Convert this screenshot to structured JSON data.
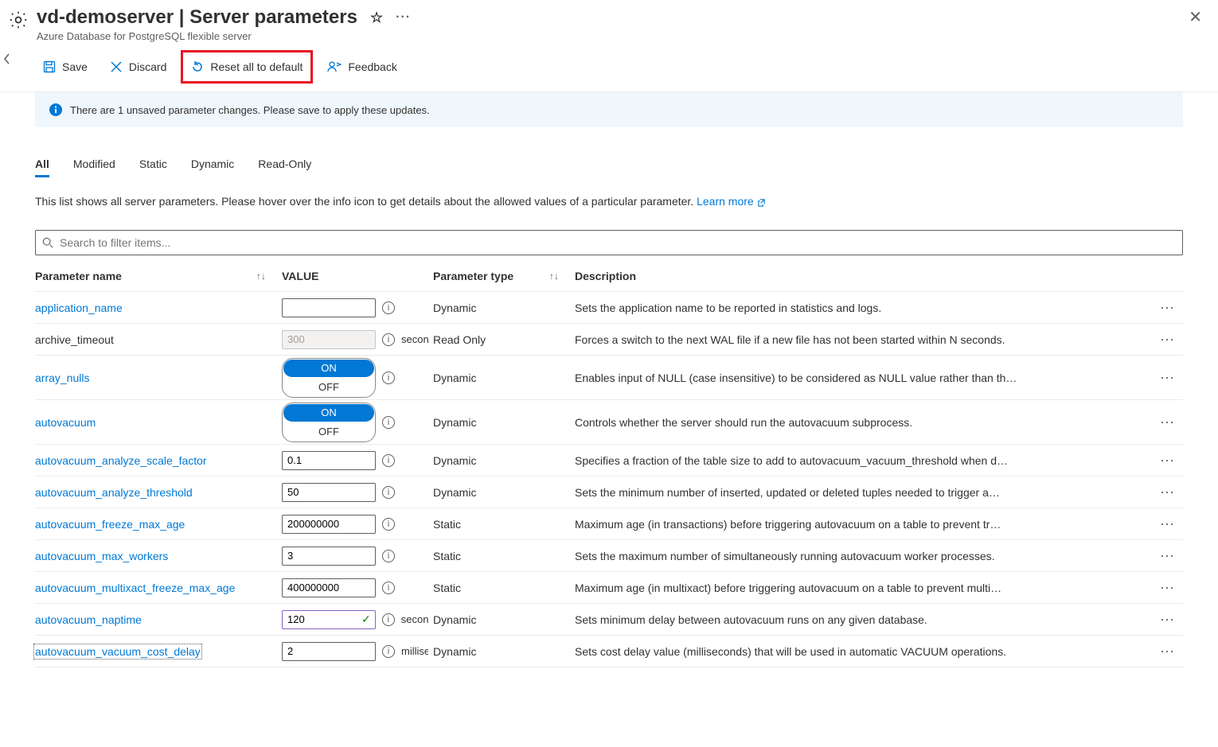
{
  "header": {
    "title": "vd-demoserver | Server parameters",
    "subtitle": "Azure Database for PostgreSQL flexible server"
  },
  "toolbar": {
    "save": "Save",
    "discard": "Discard",
    "reset": "Reset all to default",
    "feedback": "Feedback"
  },
  "info_bar": "There are 1 unsaved parameter changes.  Please save to apply these updates.",
  "tabs": [
    "All",
    "Modified",
    "Static",
    "Dynamic",
    "Read-Only"
  ],
  "desc": "This list shows all server parameters. Please hover over the info icon to get details about the allowed values of a particular parameter. ",
  "learn_more": "Learn more",
  "search_placeholder": "Search to filter items...",
  "columns": {
    "name": "Parameter name",
    "value": "VALUE",
    "type": "Parameter type",
    "desc": "Description"
  },
  "rows": [
    {
      "name": "application_name",
      "link": true,
      "value": "",
      "kind": "text",
      "type": "Dynamic",
      "desc": "Sets the application name to be reported in statistics and logs."
    },
    {
      "name": "archive_timeout",
      "link": false,
      "value": "300",
      "kind": "readonly",
      "unit": "seconds",
      "type": "Read Only",
      "desc": "Forces a switch to the next WAL file if a new file has not been started within N seconds."
    },
    {
      "name": "array_nulls",
      "link": true,
      "kind": "toggle",
      "on": "ON",
      "off": "OFF",
      "type": "Dynamic",
      "desc": "Enables input of NULL (case insensitive) to be considered as NULL value rather than th…"
    },
    {
      "name": "autovacuum",
      "link": true,
      "kind": "toggle",
      "on": "ON",
      "off": "OFF",
      "type": "Dynamic",
      "desc": "Controls whether the server should run the autovacuum subprocess."
    },
    {
      "name": "autovacuum_analyze_scale_factor",
      "link": true,
      "value": "0.1",
      "kind": "text",
      "type": "Dynamic",
      "desc": "Specifies a fraction of the table size to add to autovacuum_vacuum_threshold when d…"
    },
    {
      "name": "autovacuum_analyze_threshold",
      "link": true,
      "value": "50",
      "kind": "text",
      "type": "Dynamic",
      "desc": "Sets the minimum number of inserted, updated or deleted tuples needed to trigger a…"
    },
    {
      "name": "autovacuum_freeze_max_age",
      "link": true,
      "value": "200000000",
      "kind": "text",
      "type": "Static",
      "desc": "Maximum age (in transactions) before triggering autovacuum on a table to prevent tr…"
    },
    {
      "name": "autovacuum_max_workers",
      "link": true,
      "value": "3",
      "kind": "text",
      "type": "Static",
      "desc": "Sets the maximum number of simultaneously running autovacuum worker processes."
    },
    {
      "name": "autovacuum_multixact_freeze_max_age",
      "link": true,
      "value": "400000000",
      "kind": "text",
      "type": "Static",
      "desc": "Maximum age (in multixact) before triggering autovacuum on a table to prevent multi…"
    },
    {
      "name": "autovacuum_naptime",
      "link": true,
      "value": "120",
      "kind": "dirty",
      "unit": "seconds",
      "type": "Dynamic",
      "desc": "Sets minimum delay between autovacuum runs on any given database."
    },
    {
      "name": "autovacuum_vacuum_cost_delay",
      "link": true,
      "focus": true,
      "value": "2",
      "kind": "text",
      "unit": "milliseconds",
      "type": "Dynamic",
      "desc": "Sets cost delay value (milliseconds) that will be used in automatic VACUUM operations."
    }
  ]
}
